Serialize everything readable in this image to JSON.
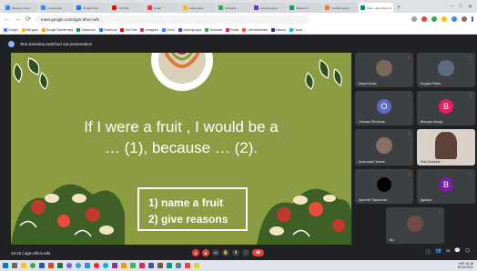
{
  "browser": {
    "tabs": [
      {
        "label": "Meeting | Zoom",
        "color": "#2d8cff"
      },
      {
        "label": "Lesson plan",
        "color": "#4285f4"
      },
      {
        "label": "Google Docs",
        "color": "#1a73e8"
      },
      {
        "label": "YouTube",
        "color": "#ff0000"
      },
      {
        "label": "Gmail",
        "color": "#ea4335"
      },
      {
        "label": "Fruits game",
        "color": "#fbbc05"
      },
      {
        "label": "Wordwall",
        "color": "#34a853"
      },
      {
        "label": "Learning apps",
        "color": "#673ab7"
      },
      {
        "label": "Classroom",
        "color": "#0f9d58"
      },
      {
        "label": "Онлайн-уроки",
        "color": "#ff7043"
      },
      {
        "label": "Meet - agm-dhov-wfs",
        "color": "#00897b",
        "active": true
      }
    ],
    "new_tab": "+",
    "url": "meet.google.com/agm-dhov-wfs",
    "bookmarks": [
      "Google",
      "Мій диск",
      "Google Презентації",
      "Classroom",
      "Facebook",
      "YouTube",
      "Instagram",
      "Zoom",
      "Learning apps",
      "Wordwall",
      "Padlet",
      "Liveworksheets",
      "Kahoot",
      "Canva"
    ]
  },
  "meeting": {
    "title": "Яна Zameina switched out presentation",
    "code": "16:15 | agm-dhov-wfs",
    "people_count": "28"
  },
  "slide": {
    "title_line1": "If I were a fruit , I would be a",
    "title_line2": "… (1), because … (2).",
    "task1": "1) name a fruit",
    "task2": "2) give reasons",
    "background": "#8c9c43"
  },
  "participants": [
    {
      "name": "Марія Білик",
      "type": "photo",
      "color": "#7a6a5a"
    },
    {
      "name": "Богдан Рябко",
      "type": "photo",
      "color": "#5e6b7d"
    },
    {
      "name": "Оленка Петренко",
      "type": "avatar",
      "initial": "O",
      "color": "#5c6bc0"
    },
    {
      "name": "Вікторія Мазур",
      "type": "avatar",
      "initial": "B",
      "color": "#e91e63"
    },
    {
      "name": "Анастасія Гнатюк",
      "type": "photo",
      "color": "#8d6e63"
    },
    {
      "name": "Яна Zameina",
      "type": "photo",
      "color": "#c9b8a8",
      "highlight": true
    },
    {
      "name": "Арсеній Тарасенко",
      "type": "avatar",
      "initial": "",
      "color": "#000000"
    },
    {
      "name": "Дмитро",
      "type": "avatar",
      "initial": "B",
      "color": "#7b1fa2"
    },
    {
      "name": "Ви",
      "type": "photo",
      "color": "#6d4c41"
    }
  ],
  "controls": {
    "mic": "🎤",
    "camera": "📷",
    "captions": "CC",
    "hand": "✋",
    "present": "⬆",
    "more": "⋮",
    "hangup": "📞"
  },
  "taskbar": {
    "time": "16:18",
    "date": "18.03.2021",
    "lang": "УКР"
  }
}
